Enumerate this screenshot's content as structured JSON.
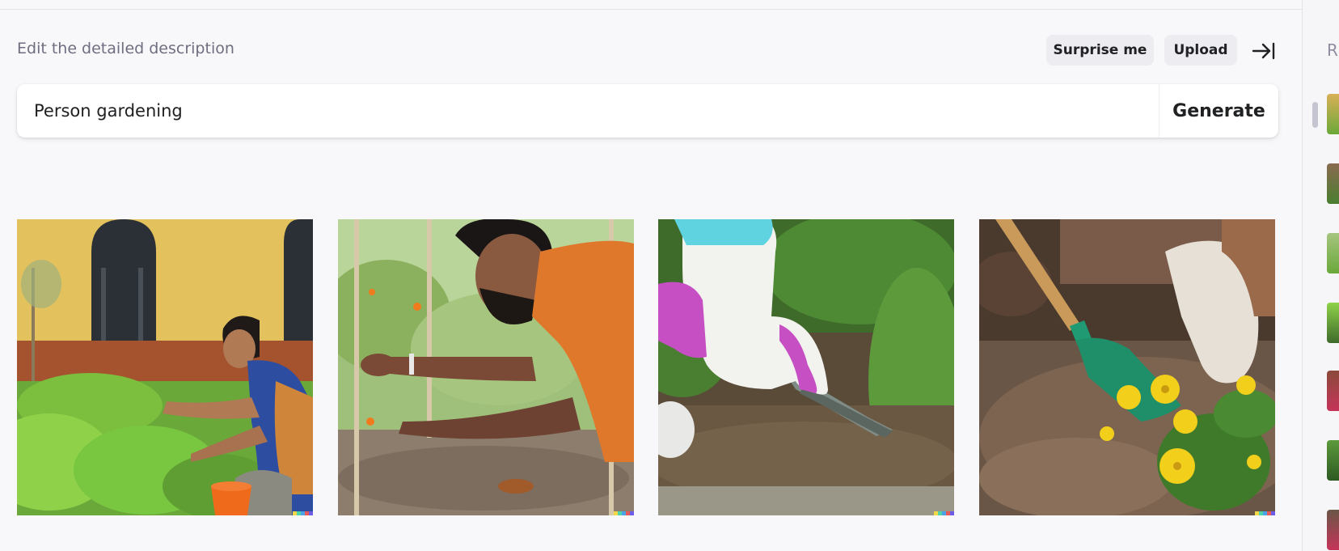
{
  "header": {
    "title": "Edit the detailed description",
    "surprise_label": "Surprise me",
    "upload_label": "Upload",
    "collapse_icon": "collapse-right-icon"
  },
  "prompt": {
    "value": "Person gardening",
    "generate_label": "Generate"
  },
  "results": [
    {
      "description": "Woman tending plants near yellow building"
    },
    {
      "description": "Bearded man in orange shirt picking flowers"
    },
    {
      "description": "Gloved hand digging with trowel"
    },
    {
      "description": "Gloved hand planting yellow flowers with shovel"
    }
  ],
  "sidebar": {
    "label": "R",
    "thumbnails": 7
  },
  "colors": {
    "background": "#f8f8fa",
    "pill": "#ececf1",
    "text": "#202123",
    "muted": "#6e6e80"
  }
}
